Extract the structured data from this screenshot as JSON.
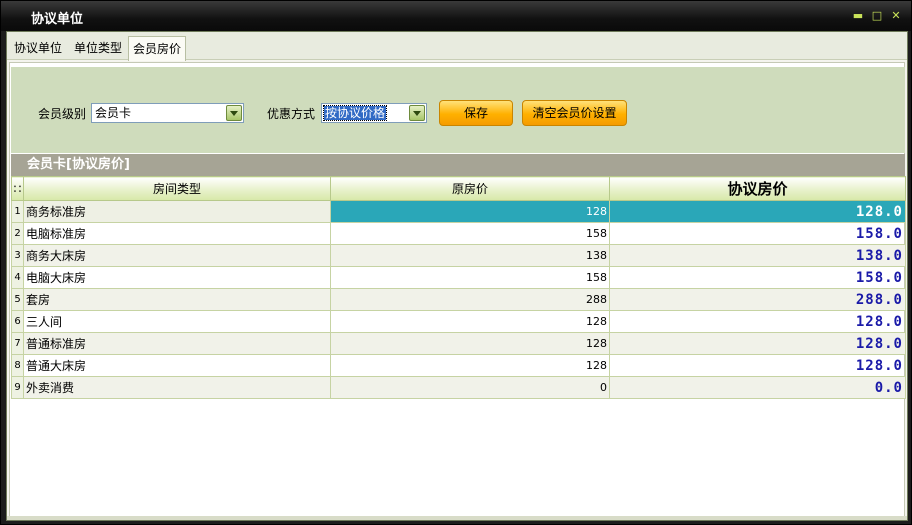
{
  "window": {
    "title": "协议单位"
  },
  "tabs": [
    {
      "label": "协议单位"
    },
    {
      "label": "单位类型"
    },
    {
      "label": "会员房价"
    }
  ],
  "filters": {
    "member_level_label": "会员级别",
    "member_level_value": "会员卡",
    "discount_label": "优惠方式",
    "discount_value": "按协议价格"
  },
  "buttons": {
    "save": "保存",
    "clear": "清空会员价设置"
  },
  "section": {
    "title": "会员卡[协议房价]"
  },
  "table": {
    "columns": {
      "idx": "∷",
      "room_type": "房间类型",
      "original": "原房价",
      "agreement": "协议房价"
    },
    "rows": [
      {
        "idx": "1",
        "room_type": "商务标准房",
        "original": "128",
        "agreement": "128.0"
      },
      {
        "idx": "2",
        "room_type": "电脑标准房",
        "original": "158",
        "agreement": "158.0"
      },
      {
        "idx": "3",
        "room_type": "商务大床房",
        "original": "138",
        "agreement": "138.0"
      },
      {
        "idx": "4",
        "room_type": "电脑大床房",
        "original": "158",
        "agreement": "158.0"
      },
      {
        "idx": "5",
        "room_type": "套房",
        "original": "288",
        "agreement": "288.0"
      },
      {
        "idx": "6",
        "room_type": "三人间",
        "original": "128",
        "agreement": "128.0"
      },
      {
        "idx": "7",
        "room_type": "普通标准房",
        "original": "128",
        "agreement": "128.0"
      },
      {
        "idx": "8",
        "room_type": "普通大床房",
        "original": "128",
        "agreement": "128.0"
      },
      {
        "idx": "9",
        "room_type": "外卖消费",
        "original": "0",
        "agreement": "0.0"
      }
    ]
  },
  "colors": {
    "selected_row": "#2aa7b8",
    "agreement_text": "#1a1aa8",
    "button_orange": "#ffb000"
  }
}
